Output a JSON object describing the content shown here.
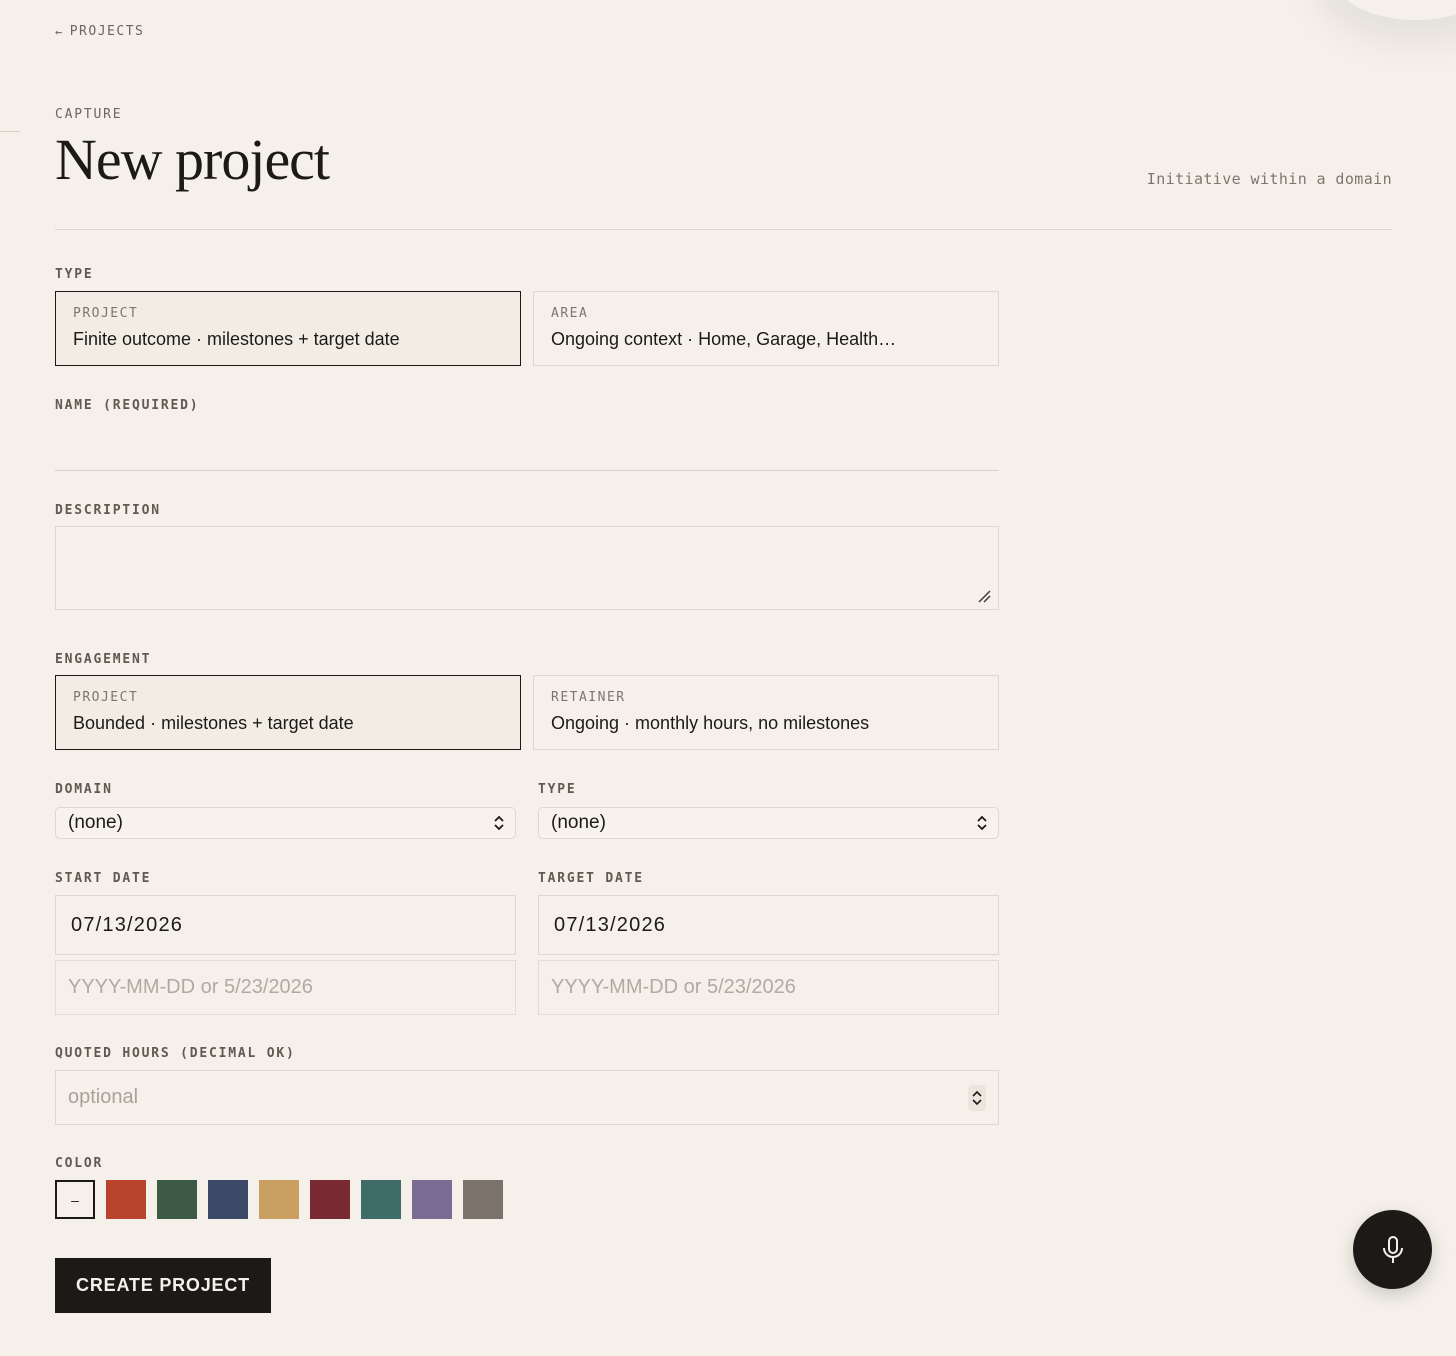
{
  "nav": {
    "back_label": "PROJECTS"
  },
  "header": {
    "eyebrow": "CAPTURE",
    "title": "New project",
    "subtitle": "Initiative within a domain"
  },
  "type_section": {
    "label": "TYPE",
    "options": [
      {
        "title": "PROJECT",
        "description": "Finite outcome · milestones + target date",
        "selected": true
      },
      {
        "title": "AREA",
        "description": "Ongoing context · Home, Garage, Health…",
        "selected": false
      }
    ]
  },
  "name_field": {
    "label": "NAME (REQUIRED)",
    "value": ""
  },
  "description_field": {
    "label": "DESCRIPTION",
    "value": ""
  },
  "engagement_section": {
    "label": "ENGAGEMENT",
    "options": [
      {
        "title": "PROJECT",
        "description": "Bounded · milestones + target date",
        "selected": true
      },
      {
        "title": "RETAINER",
        "description": "Ongoing · monthly hours, no milestones",
        "selected": false
      }
    ]
  },
  "domain_field": {
    "label": "DOMAIN",
    "value": "(none)"
  },
  "type_select": {
    "label": "TYPE",
    "value": "(none)"
  },
  "start_date": {
    "label": "START DATE",
    "value": "07/13/2026",
    "hint": "YYYY-MM-DD or 5/23/2026"
  },
  "target_date": {
    "label": "TARGET DATE",
    "value": "07/13/2026",
    "hint": "YYYY-MM-DD or 5/23/2026"
  },
  "quoted_hours": {
    "label": "QUOTED HOURS (DECIMAL OK)",
    "placeholder": "optional"
  },
  "color_section": {
    "label": "COLOR",
    "none_label": "–",
    "swatches": [
      "#b8442b",
      "#3d5a45",
      "#3b4868",
      "#c9a062",
      "#7a2a33",
      "#3f6b69",
      "#7a6c92",
      "#7b736b"
    ]
  },
  "submit": {
    "label": "CREATE PROJECT"
  },
  "colors": {
    "background": "#f5f1ea",
    "ink": "#1c1a17",
    "muted": "#6b665e"
  },
  "icons": {
    "back": "arrow-left-icon",
    "mic": "microphone-icon",
    "select": "chevron-updown-icon"
  }
}
